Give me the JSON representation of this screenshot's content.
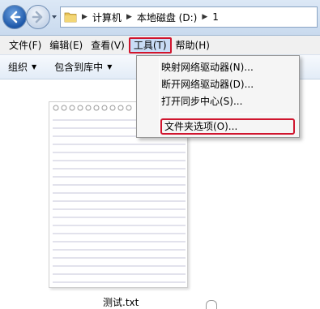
{
  "address_bar": {
    "breadcrumbs": [
      "计算机",
      "本地磁盘 (D:)",
      "1"
    ]
  },
  "menu_bar": {
    "items": [
      {
        "label": "文件(F)"
      },
      {
        "label": "编辑(E)"
      },
      {
        "label": "查看(V)"
      },
      {
        "label": "工具(T)",
        "active": true
      },
      {
        "label": "帮助(H)"
      }
    ]
  },
  "toolbar": {
    "organize_label": "组织",
    "include_library_label": "包含到库中"
  },
  "tools_menu": {
    "items": [
      {
        "label": "映射网络驱动器(N)..."
      },
      {
        "label": "断开网络驱动器(D)..."
      },
      {
        "label": "打开同步中心(S)..."
      },
      {
        "label": "文件夹选项(O)...",
        "highlighted": true
      }
    ]
  },
  "files": [
    {
      "name": "测试.txt",
      "icon": "text-file-icon"
    }
  ],
  "colors": {
    "highlight_border": "#d0152e",
    "menu_active_bg": "#c9dcf5",
    "nav_back": "#1d57a8"
  }
}
